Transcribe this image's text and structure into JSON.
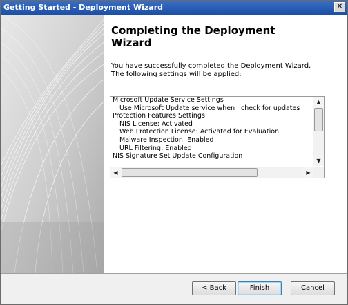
{
  "window": {
    "title": "Getting Started - Deployment Wizard",
    "close_glyph": "✕"
  },
  "heading": "Completing the Deployment Wizard",
  "intro": {
    "line1": "You have successfully completed the Deployment Wizard.",
    "line2": "The following settings will be applied:"
  },
  "settings": [
    {
      "text": "Microsoft Update Service Settings",
      "indent": 0
    },
    {
      "text": "Use Microsoft Update service when I check for updates",
      "indent": 1
    },
    {
      "text": "Protection Features Settings",
      "indent": 0
    },
    {
      "text": "NIS License: Activated",
      "indent": 1
    },
    {
      "text": "Web Protection License: Activated for Evaluation",
      "indent": 1
    },
    {
      "text": "Malware Inspection: Enabled",
      "indent": 1
    },
    {
      "text": "URL Filtering: Enabled",
      "indent": 1
    },
    {
      "text": "NIS Signature Set Update Configuration",
      "indent": 0
    }
  ],
  "scroll_glyphs": {
    "up": "▲",
    "down": "▼",
    "left": "◀",
    "right": "▶"
  },
  "buttons": {
    "back": "< Back",
    "finish": "Finish",
    "cancel": "Cancel"
  },
  "colors": {
    "titlebar": "#1c4fa5",
    "sidebar": "#c9c9c9",
    "default_button_border": "#3c7fb1"
  }
}
